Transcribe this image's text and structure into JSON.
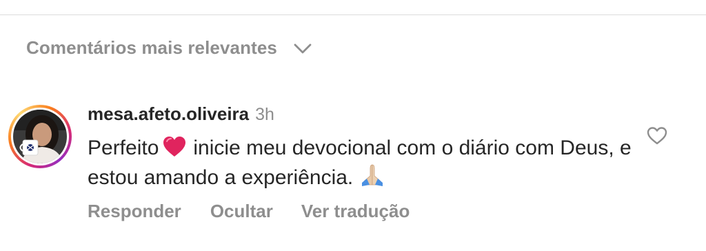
{
  "sort": {
    "label": "Comentários mais relevantes",
    "icon": "chevron-down-icon"
  },
  "comment": {
    "username": "mesa.afeto.oliveira",
    "time": "3h",
    "text_before_emoji": "Perfeito",
    "text_after_heart": "inicie meu devocional com o diário com Deus, e estou amando a experiência.",
    "emojis": [
      "red-heart-icon",
      "praying-hands-icon"
    ],
    "like_icon": "heart-outline-icon"
  },
  "actions": {
    "reply": "Responder",
    "hide": "Ocultar",
    "translate": "Ver tradução"
  },
  "colors": {
    "primary_text": "#262626",
    "secondary_text": "#8e8e8e",
    "divider": "#dbdbdb",
    "heart": "#e0245e"
  }
}
